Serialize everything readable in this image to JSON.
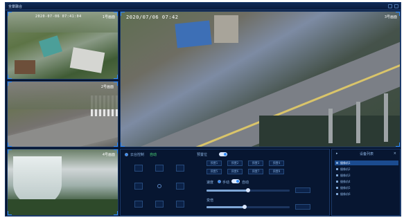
{
  "window": {
    "title": "全景融合"
  },
  "video": {
    "main_timestamp": "2020/07/06 07:42",
    "pane1_timestamp": "2020-07-06 07:41:04",
    "pane1_label": "1号画面",
    "pane2_label": "2号画面",
    "pane3_label": "3号画面",
    "pane4_label": "4号画面"
  },
  "controls": {
    "ptz_title": "云台控制",
    "auto_label": "自动",
    "preset_title": "预置位",
    "preset_buttons": [
      "预置1",
      "预置2",
      "预置3",
      "预置4",
      "预置5",
      "预置6",
      "预置7",
      "预置8"
    ],
    "speed_label": "速度",
    "zoom_label": "变倍",
    "mode_a": "手动",
    "mode_b": "自动"
  },
  "camera_list": {
    "title": "设备列表",
    "items": [
      "摄像机1",
      "摄像机2",
      "摄像机3",
      "摄像机4",
      "摄像机5",
      "摄像机6"
    ]
  },
  "colors": {
    "accent": "#2f8cff",
    "panel_bg": "#071631",
    "active_item": "#1b4b8f"
  }
}
